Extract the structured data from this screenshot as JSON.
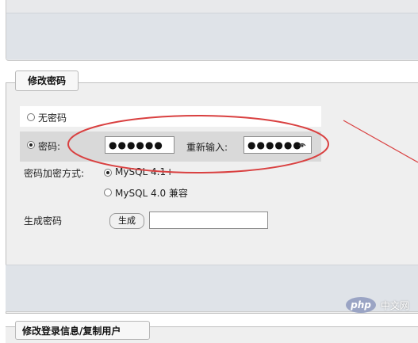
{
  "section": {
    "legend": "修改密码",
    "no_password_label": "无密码",
    "password_label": "密码:",
    "password_value": "●●●●●●",
    "reenter_label": "重新输入:",
    "reenter_value": "●●●●●●",
    "hashing_label": "密码加密方式:",
    "hash_options": [
      {
        "label": "MySQL 4.1+",
        "selected": true
      },
      {
        "label": "MySQL 4.0 兼容",
        "selected": false
      }
    ],
    "generate_label": "生成密码",
    "generate_button": "生成",
    "generated_value": ""
  },
  "next_section": {
    "legend": "修改登录信息/复制用户"
  },
  "watermark": {
    "logo": "php",
    "text": "中文网"
  },
  "colors": {
    "annotation": "#d94040",
    "panel": "#dfe3e8",
    "fieldset": "#efefef"
  }
}
